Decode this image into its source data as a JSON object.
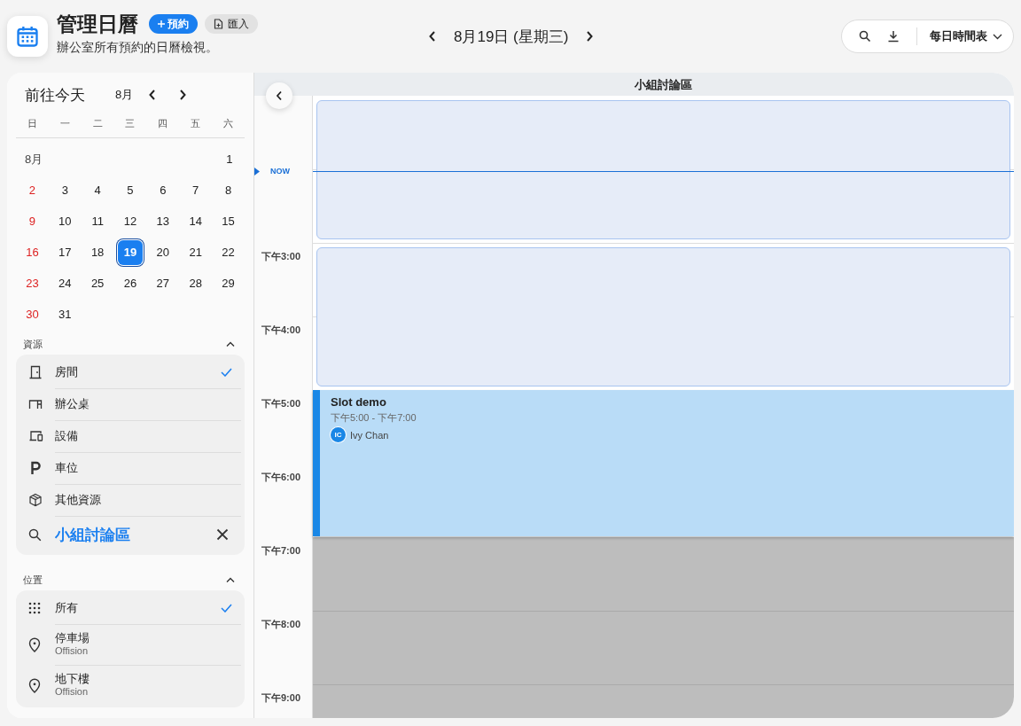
{
  "header": {
    "title": "管理日曆",
    "subtitle": "辦公室所有預約的日曆檢視。",
    "book_button": "預約",
    "import_button": "匯入"
  },
  "date_nav": {
    "date": "8月19日 (星期三)"
  },
  "toolbar": {
    "view_select": "每日時間表"
  },
  "mini_calendar": {
    "today_button": "前往今天",
    "month": "8月",
    "weekdays": [
      "日",
      "一",
      "二",
      "三",
      "四",
      "五",
      "六"
    ],
    "month_label": "8月",
    "weeks": [
      [
        {
          "label": "1",
          "selected": false
        }
      ],
      [
        {
          "label": "2",
          "selected": false
        },
        {
          "label": "3",
          "selected": false
        },
        {
          "label": "4",
          "selected": false
        },
        {
          "label": "5",
          "selected": false
        },
        {
          "label": "6",
          "selected": false
        },
        {
          "label": "7",
          "selected": false
        },
        {
          "label": "8",
          "selected": false
        }
      ],
      [
        {
          "label": "9",
          "selected": false
        },
        {
          "label": "10",
          "selected": false
        },
        {
          "label": "11",
          "selected": false
        },
        {
          "label": "12",
          "selected": false
        },
        {
          "label": "13",
          "selected": false
        },
        {
          "label": "14",
          "selected": false
        },
        {
          "label": "15",
          "selected": false
        }
      ],
      [
        {
          "label": "16",
          "selected": false
        },
        {
          "label": "17",
          "selected": false
        },
        {
          "label": "18",
          "selected": false
        },
        {
          "label": "19",
          "selected": true
        },
        {
          "label": "20",
          "selected": false
        },
        {
          "label": "21",
          "selected": false
        },
        {
          "label": "22",
          "selected": false
        }
      ],
      [
        {
          "label": "23",
          "selected": false
        },
        {
          "label": "24",
          "selected": false
        },
        {
          "label": "25",
          "selected": false
        },
        {
          "label": "26",
          "selected": false
        },
        {
          "label": "27",
          "selected": false
        },
        {
          "label": "28",
          "selected": false
        },
        {
          "label": "29",
          "selected": false
        }
      ],
      [
        {
          "label": "30",
          "selected": false
        },
        {
          "label": "31",
          "selected": false
        }
      ]
    ]
  },
  "resources": {
    "title": "資源",
    "expanded": true,
    "items": [
      {
        "kind": "room",
        "label": "房間",
        "checked": true
      },
      {
        "kind": "desk",
        "label": "辦公桌",
        "checked": false
      },
      {
        "kind": "equipment",
        "label": "設備",
        "checked": false
      },
      {
        "kind": "parking",
        "label": "車位",
        "checked": false
      },
      {
        "kind": "other",
        "label": "其他資源",
        "checked": false
      }
    ],
    "search": {
      "value": "小組討論區"
    }
  },
  "locations": {
    "title": "位置",
    "expanded": true,
    "items": [
      {
        "kind": "all",
        "label": "所有",
        "checked": true
      },
      {
        "kind": "pin",
        "label": "停車場",
        "sublabel": "Offision",
        "checked": false
      },
      {
        "kind": "pin",
        "label": "地下樓",
        "sublabel": "Offision",
        "checked": false
      }
    ]
  },
  "schedule": {
    "column": "小組討論區",
    "now_label": "NOW",
    "hours": [
      "下午3:00",
      "下午4:00",
      "下午5:00",
      "下午6:00",
      "下午7:00",
      "下午8:00",
      "下午9:00"
    ],
    "event": {
      "title": "Slot demo",
      "time": "下午5:00 - 下午7:00",
      "person": "Ivy Chan",
      "initials": "IC"
    }
  }
}
